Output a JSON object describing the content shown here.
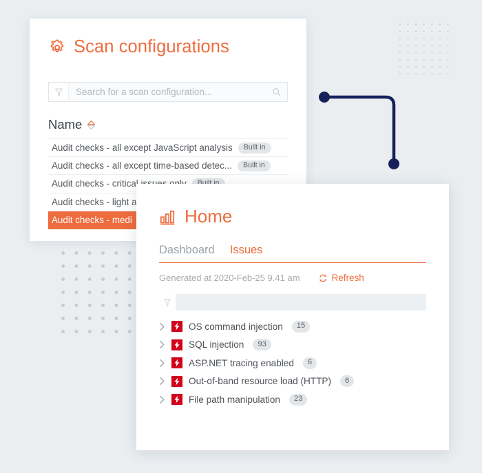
{
  "colors": {
    "accent_orange": "#ee6c3e",
    "severity_red": "#d1011c",
    "navy": "#16205a",
    "page_background": "#eaeef1",
    "badge_gray": "#e3e6e8"
  },
  "scan_card": {
    "title": "Scan configurations",
    "gear_icon": "gear-icon",
    "search": {
      "placeholder": "Search for a scan configuration...",
      "value": "",
      "filter_icon": "funnel-icon",
      "search_icon": "magnifier-icon"
    },
    "column_header": {
      "label": "Name",
      "sort_icon": "sort-diamond-icon"
    },
    "rows": [
      {
        "name": "Audit checks - all except JavaScript analysis",
        "badge": "Built in",
        "selected": false
      },
      {
        "name": "Audit checks - all except time-based detec...",
        "badge": "Built in",
        "selected": false
      },
      {
        "name": "Audit checks - critical issues only",
        "badge": "Built in",
        "selected": false
      },
      {
        "name": "Audit checks - light a",
        "badge": "",
        "selected": false
      },
      {
        "name": "Audit checks - medi",
        "badge": "",
        "selected": true
      }
    ]
  },
  "home_card": {
    "title": "Home",
    "chart_icon": "bar-chart-icon",
    "tabs": [
      {
        "label": "Dashboard",
        "active": false
      },
      {
        "label": "Issues",
        "active": true
      }
    ],
    "generated_at": "Generated at 2020-Feb-25 9.41 am",
    "refresh": {
      "label": "Refresh",
      "icon": "refresh-icon"
    },
    "issue_filter": {
      "icon": "funnel-icon",
      "value": ""
    },
    "issues": [
      {
        "name": "OS command injection",
        "count": "15",
        "severity_icon": "high-severity-icon",
        "expand_icon": "chevron-right-icon"
      },
      {
        "name": "SQL injection",
        "count": "93",
        "severity_icon": "high-severity-icon",
        "expand_icon": "chevron-right-icon"
      },
      {
        "name": "ASP.NET tracing enabled",
        "count": "6",
        "severity_icon": "high-severity-icon",
        "expand_icon": "chevron-right-icon"
      },
      {
        "name": "Out-of-band resource load (HTTP)",
        "count": "6",
        "severity_icon": "high-severity-icon",
        "expand_icon": "chevron-right-icon"
      },
      {
        "name": "File path manipulation",
        "count": "23",
        "severity_icon": "high-severity-icon",
        "expand_icon": "chevron-right-icon"
      }
    ]
  },
  "decorations": {
    "connector": "connector-line",
    "dots_top_right": "dot-grid-pattern",
    "dots_bottom_left": "dot-grid-pattern"
  }
}
